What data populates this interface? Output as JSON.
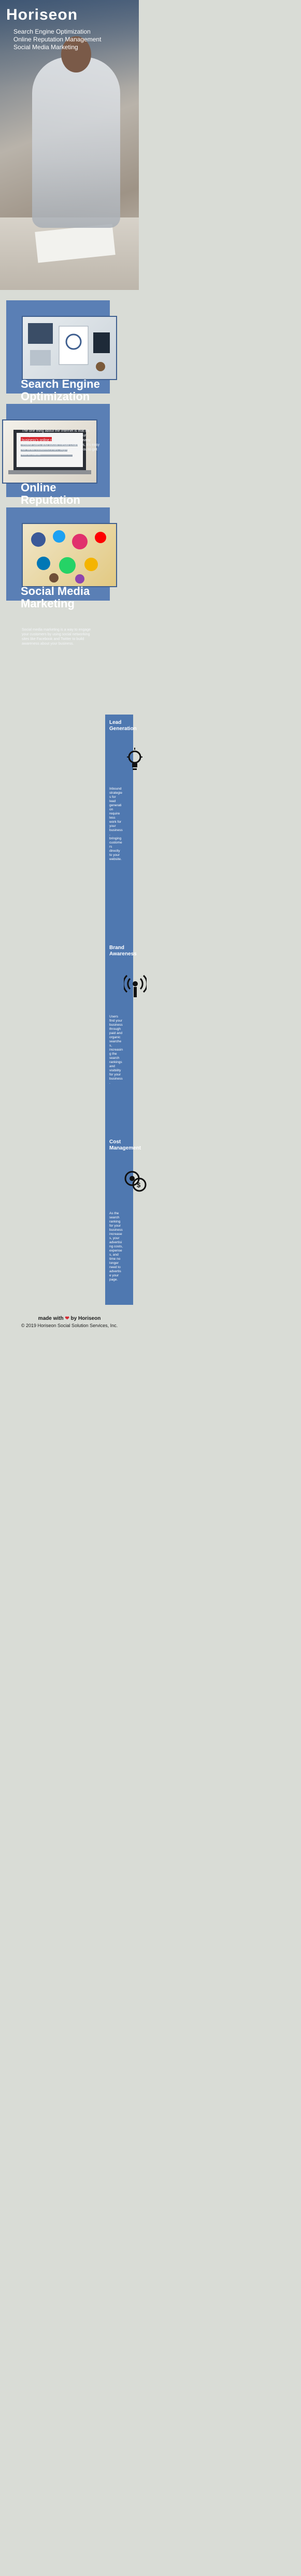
{
  "header": {
    "logo": "Horiseon",
    "nav": [
      "Search Engine Optimization",
      "Online Reputation Management",
      "Social Media Marketing"
    ]
  },
  "services": [
    {
      "title": "Search Engine Optimization",
      "text": ""
    },
    {
      "title": "Online Reputation Management",
      "text": "The one thing about the Internet is that it's always on. The same holds true for your business's online reputation. With so many review sites and social media channels, it's easy for what customers are saying about you to get out of hand."
    },
    {
      "title": "Social Media Marketing",
      "text": "Social media marketing is a way to engage your customers by using social networking sites like Facebook and Twitter to build awareness about your business."
    }
  ],
  "benefits": [
    {
      "title": "Lead Generation",
      "icon": "lead-icon",
      "text": "Inbound strategies for lead generation require less work for your business, bringing customers directly to your website."
    },
    {
      "title": "Brand Awareness",
      "icon": "brand-icon",
      "text": "Users find your business through paid and organic searches, increasing the search rankings and visibility for your business."
    },
    {
      "title": "Cost Management",
      "icon": "cost-icon",
      "text": "As the search ranking for your business increases, your advertising costs, expenses, and time no longer need to advertise your page."
    }
  ],
  "footer": {
    "made_prefix": "made with",
    "made_suffix": "by Horiseon",
    "copyright": "© 2019 Horiseon Social Solution Services, Inc."
  },
  "colors": {
    "accent": "#5a7fb5",
    "benefits_bg": "#4f78b0",
    "page_bg": "#d9dcd6",
    "heart": "#d6262f"
  }
}
